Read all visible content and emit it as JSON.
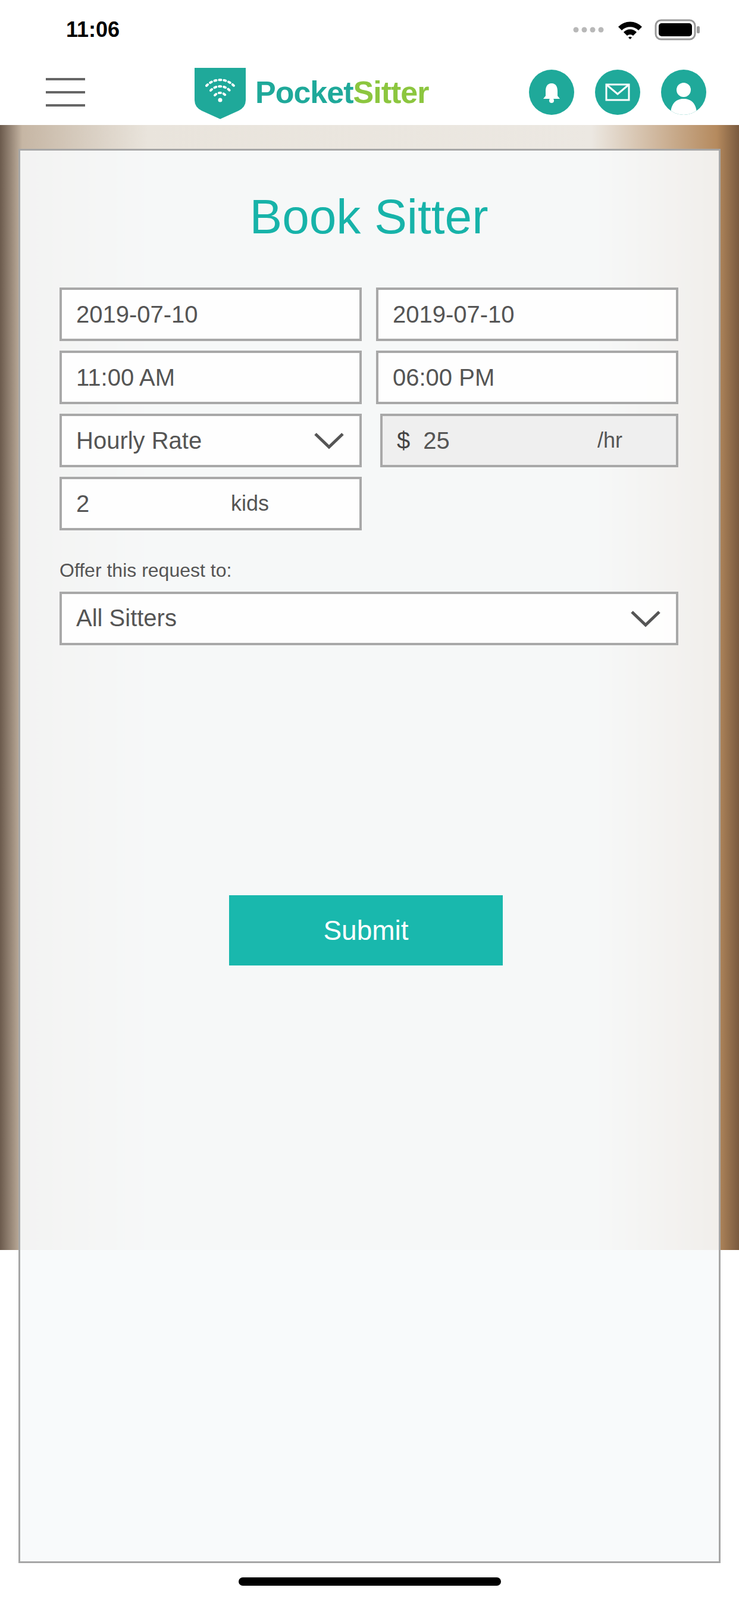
{
  "status_bar": {
    "time": "11:06"
  },
  "header": {
    "logo": {
      "part1": "Pocket",
      "part2": "Sitter"
    }
  },
  "form": {
    "title": "Book Sitter",
    "fields": [
      {
        "kind": "text",
        "value": "2019-07-10"
      },
      {
        "kind": "text",
        "value": "2019-07-10"
      },
      {
        "kind": "text",
        "value": "11:00 AM"
      },
      {
        "kind": "text",
        "value": "06:00 PM"
      },
      {
        "kind": "select",
        "value": "Hourly Rate"
      },
      {
        "kind": "money",
        "prefix": "$",
        "value": "25",
        "suffix": "/hr"
      },
      {
        "kind": "count",
        "value": "2",
        "suffix": "kids"
      }
    ],
    "offer": {
      "label": "Offer this request to:",
      "value": "All Sitters"
    },
    "submit": "Submit"
  }
}
